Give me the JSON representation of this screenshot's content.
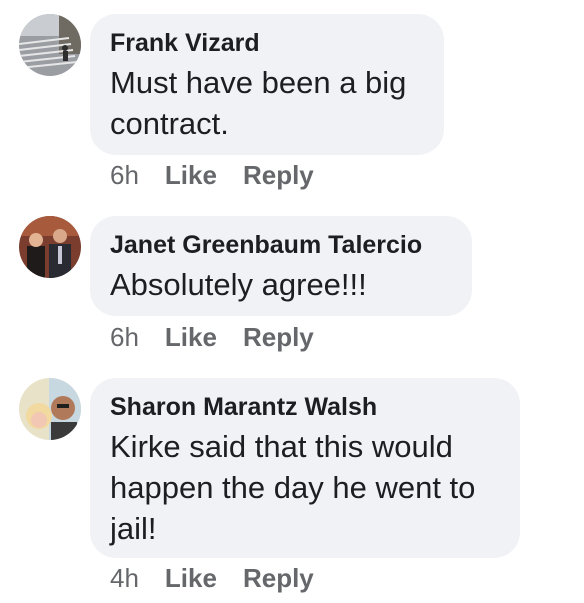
{
  "comments": [
    {
      "author": "Frank Vizard",
      "text": "Must have been a big contract.",
      "time": "6h",
      "like_label": "Like",
      "reply_label": "Reply"
    },
    {
      "author": "Janet Greenbaum Talercio",
      "text": "Absolutely agree!!!",
      "time": "6h",
      "like_label": "Like",
      "reply_label": "Reply"
    },
    {
      "author": "Sharon Marantz Walsh",
      "text": "Kirke said that this would happen the day he went to jail!",
      "time": "4h",
      "like_label": "Like",
      "reply_label": "Reply"
    }
  ],
  "colors": {
    "bubble": "#f0f2f5",
    "meta_text": "#65676b",
    "body_text": "#1c1e21"
  }
}
